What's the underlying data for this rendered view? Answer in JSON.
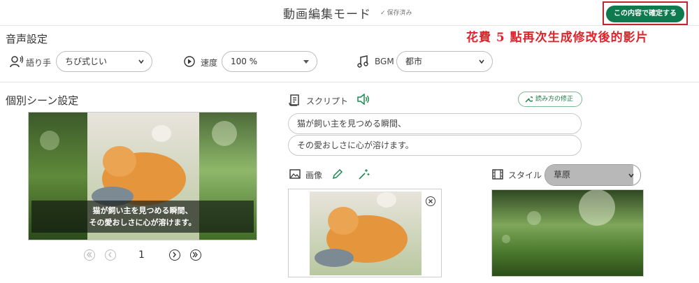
{
  "header": {
    "title": "動画編集モード",
    "saved_status": "保存済み",
    "confirm_button": "この内容で確定する"
  },
  "annotation": "花費 5 點再次生成修改後的影片",
  "audio": {
    "section_title": "音声設定",
    "narrator_label": "語り手",
    "narrator_value": "ちび式じい",
    "speed_label": "速度",
    "speed_value": "100 %",
    "bgm_label": "BGM",
    "bgm_value": "都市"
  },
  "scene": {
    "section_title": "個別シーン設定",
    "caption_line1": "猫が飼い主を見つめる瞬間、",
    "caption_line2": "その愛おしさに心が溶けます。",
    "page_number": "1"
  },
  "script": {
    "label": "スクリプト",
    "reading_fix_button": "読み方の修正",
    "lines": [
      "猫が飼い主を見つめる瞬間、",
      "その愛おしさに心が溶けます。"
    ]
  },
  "image": {
    "label": "画像"
  },
  "style": {
    "label": "スタイル",
    "value": "草原"
  },
  "colors": {
    "accent": "#0f7a4f",
    "annotation": "#e0232a"
  }
}
